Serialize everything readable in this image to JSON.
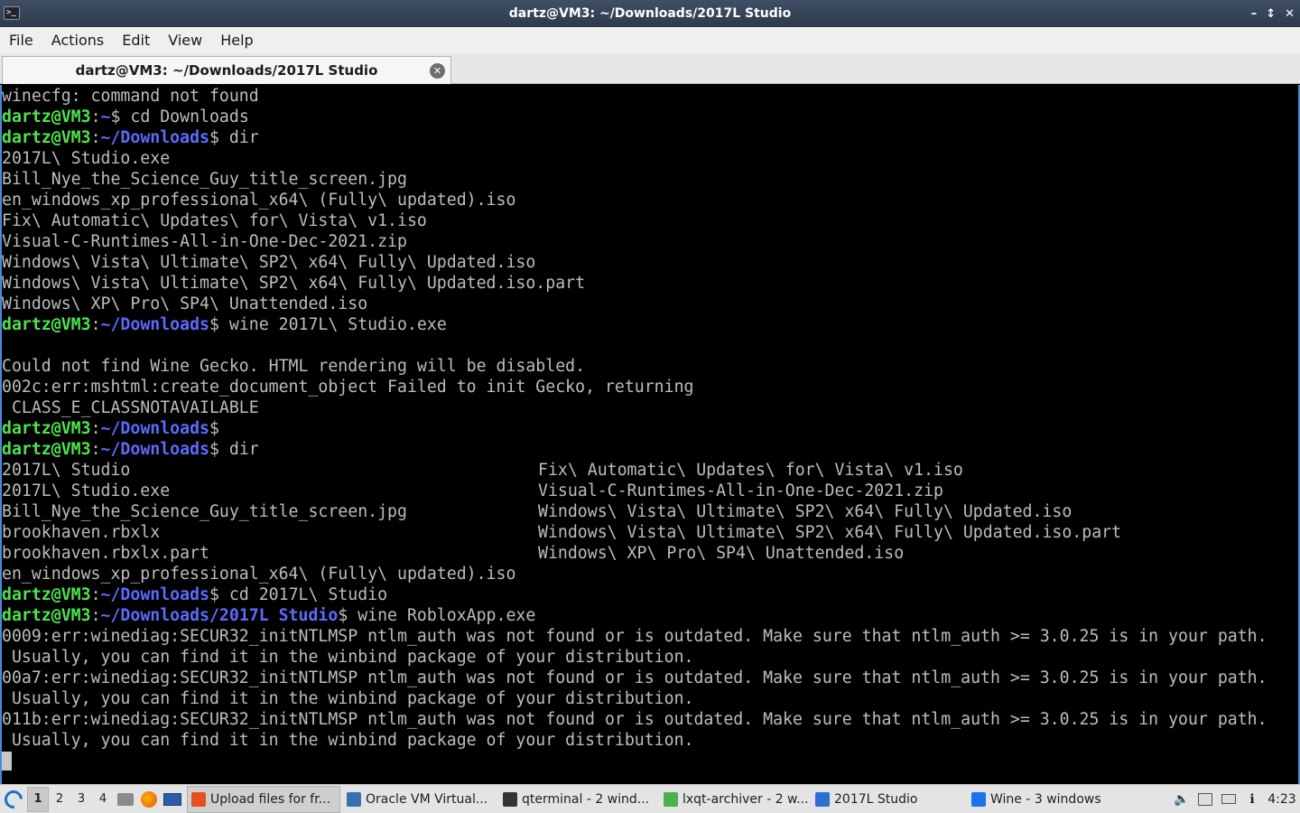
{
  "window": {
    "title": "dartz@VM3: ~/Downloads/2017L Studio",
    "controls": [
      "–",
      "↕",
      "✕"
    ]
  },
  "menu": [
    "File",
    "Actions",
    "Edit",
    "View",
    "Help"
  ],
  "tab": {
    "label": "dartz@VM3: ~/Downloads/2017L Studio"
  },
  "prompt": {
    "user": "dartz@VM3",
    "sep": ":"
  },
  "terminal": {
    "lines": [
      {
        "t": "plain",
        "text": "winecfg: command not found"
      },
      {
        "t": "prompt",
        "path": "~",
        "cmd": "$ cd Downloads"
      },
      {
        "t": "prompt",
        "path": "~/Downloads",
        "cmd": "$ dir"
      },
      {
        "t": "plain",
        "text": "2017L\\ Studio.exe"
      },
      {
        "t": "plain",
        "text": "Bill_Nye_the_Science_Guy_title_screen.jpg"
      },
      {
        "t": "plain",
        "text": "en_windows_xp_professional_x64\\ (Fully\\ updated).iso"
      },
      {
        "t": "plain",
        "text": "Fix\\ Automatic\\ Updates\\ for\\ Vista\\ v1.iso"
      },
      {
        "t": "plain",
        "text": "Visual-C-Runtimes-All-in-One-Dec-2021.zip"
      },
      {
        "t": "plain",
        "text": "Windows\\ Vista\\ Ultimate\\ SP2\\ x64\\ Fully\\ Updated.iso"
      },
      {
        "t": "plain",
        "text": "Windows\\ Vista\\ Ultimate\\ SP2\\ x64\\ Fully\\ Updated.iso.part"
      },
      {
        "t": "plain",
        "text": "Windows\\ XP\\ Pro\\ SP4\\ Unattended.iso"
      },
      {
        "t": "prompt",
        "path": "~/Downloads",
        "cmd": "$ wine 2017L\\ Studio.exe"
      },
      {
        "t": "plain",
        "text": ""
      },
      {
        "t": "plain",
        "text": "Could not find Wine Gecko. HTML rendering will be disabled."
      },
      {
        "t": "plain",
        "text": "002c:err:mshtml:create_document_object Failed to init Gecko, returning"
      },
      {
        "t": "plain",
        "text": " CLASS_E_CLASSNOTAVAILABLE"
      },
      {
        "t": "prompt",
        "path": "~/Downloads",
        "cmd": "$"
      },
      {
        "t": "prompt",
        "path": "~/Downloads",
        "cmd": "$ dir"
      },
      {
        "t": "cols",
        "a": "2017L\\ Studio",
        "b": "Fix\\ Automatic\\ Updates\\ for\\ Vista\\ v1.iso"
      },
      {
        "t": "cols",
        "a": "2017L\\ Studio.exe",
        "b": "Visual-C-Runtimes-All-in-One-Dec-2021.zip"
      },
      {
        "t": "cols",
        "a": "Bill_Nye_the_Science_Guy_title_screen.jpg",
        "b": "Windows\\ Vista\\ Ultimate\\ SP2\\ x64\\ Fully\\ Updated.iso"
      },
      {
        "t": "cols",
        "a": "brookhaven.rbxlx",
        "b": "Windows\\ Vista\\ Ultimate\\ SP2\\ x64\\ Fully\\ Updated.iso.part"
      },
      {
        "t": "cols",
        "a": "brookhaven.rbxlx.part",
        "b": "Windows\\ XP\\ Pro\\ SP4\\ Unattended.iso"
      },
      {
        "t": "plain",
        "text": "en_windows_xp_professional_x64\\ (Fully\\ updated).iso"
      },
      {
        "t": "prompt",
        "path": "~/Downloads",
        "cmd": "$ cd 2017L\\ Studio"
      },
      {
        "t": "prompt",
        "path": "~/Downloads/2017L Studio",
        "cmd": "$ wine RobloxApp.exe"
      },
      {
        "t": "plain",
        "text": "0009:err:winediag:SECUR32_initNTLMSP ntlm_auth was not found or is outdated. Make sure that ntlm_auth >= 3.0.25 is in your path."
      },
      {
        "t": "plain",
        "text": " Usually, you can find it in the winbind package of your distribution."
      },
      {
        "t": "plain",
        "text": "00a7:err:winediag:SECUR32_initNTLMSP ntlm_auth was not found or is outdated. Make sure that ntlm_auth >= 3.0.25 is in your path."
      },
      {
        "t": "plain",
        "text": " Usually, you can find it in the winbind package of your distribution."
      },
      {
        "t": "plain",
        "text": "011b:err:winediag:SECUR32_initNTLMSP ntlm_auth was not found or is outdated. Make sure that ntlm_auth >= 3.0.25 is in your path."
      },
      {
        "t": "plain",
        "text": " Usually, you can find it in the winbind package of your distribution."
      }
    ]
  },
  "colors": {
    "prompt_user": "#4ee24e",
    "prompt_path": "#5b6bff",
    "output": "#bdbdbd",
    "accent": "#4a8bd6"
  },
  "taskbar": {
    "desktops": [
      "1",
      "2",
      "3",
      "4"
    ],
    "quicklaunch": [
      "folder-icon",
      "firefox-icon",
      "show-desktop-icon"
    ],
    "tasks": [
      {
        "label": "Upload files for fr...",
        "icon": "firefox-icon",
        "color": "#e4501f",
        "active": true,
        "width": 170
      },
      {
        "label": "Oracle VM Virtual...",
        "icon": "virtualbox-icon",
        "color": "#3a6fb0",
        "active": false,
        "width": 170
      },
      {
        "label": "qterminal - 2 wind...",
        "icon": "terminal-icon",
        "color": "#333333",
        "active": false,
        "width": 175
      },
      {
        "label": "lxqt-archiver - 2 w...",
        "icon": "archiver-icon",
        "color": "#4caf50",
        "active": false,
        "width": 165
      },
      {
        "label": "2017L Studio",
        "icon": "folder-icon",
        "color": "#2c6fd1",
        "active": false,
        "width": 170
      },
      {
        "label": "Wine - 3 windows",
        "icon": "wine-icon",
        "color": "#1a73e8",
        "active": false,
        "width": 165
      }
    ],
    "tray": [
      "volume-icon",
      "clipboard-icon",
      "keyboard-icon",
      "network-icon"
    ],
    "clock": "4:23"
  }
}
